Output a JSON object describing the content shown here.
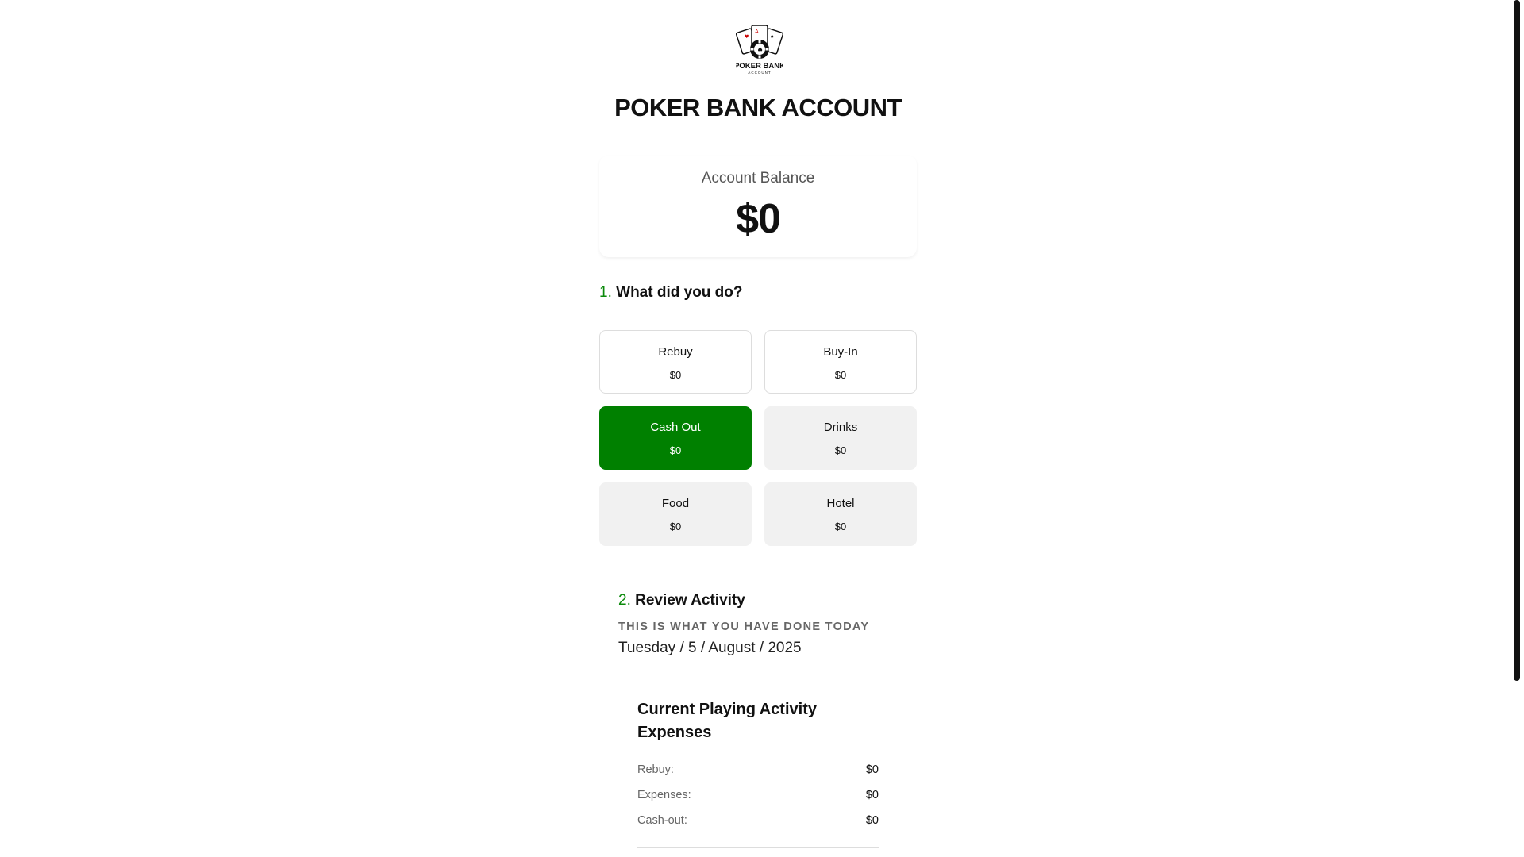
{
  "brand": {
    "logo_text": "POKER BANK",
    "logo_subtext": "ACCOUNT",
    "title": "POKER BANK ACCOUNT"
  },
  "balance": {
    "label": "Account Balance",
    "value": "$0"
  },
  "step1": {
    "number": "1.",
    "title": "What did you do?"
  },
  "actions": [
    {
      "label": "Rebuy",
      "value": "$0"
    },
    {
      "label": "Buy-In",
      "value": "$0"
    },
    {
      "label": "Cash Out",
      "value": "$0"
    },
    {
      "label": "Drinks",
      "value": "$0"
    },
    {
      "label": "Food",
      "value": "$0"
    },
    {
      "label": "Hotel",
      "value": "$0"
    }
  ],
  "step2": {
    "number": "2.",
    "title": "Review Activity",
    "subtitle": "THIS IS WHAT YOU HAVE DONE TODAY",
    "date": "Tuesday / 5 / August / 2025"
  },
  "expenses": {
    "title": "Current Playing Activity Expenses",
    "rows": [
      {
        "label": "Rebuy:",
        "value": "$0"
      },
      {
        "label": "Expenses:",
        "value": "$0"
      },
      {
        "label": "Cash-out:",
        "value": "$0"
      }
    ]
  },
  "colors": {
    "accent": "#008000",
    "step_number": "#0b8a0b"
  }
}
